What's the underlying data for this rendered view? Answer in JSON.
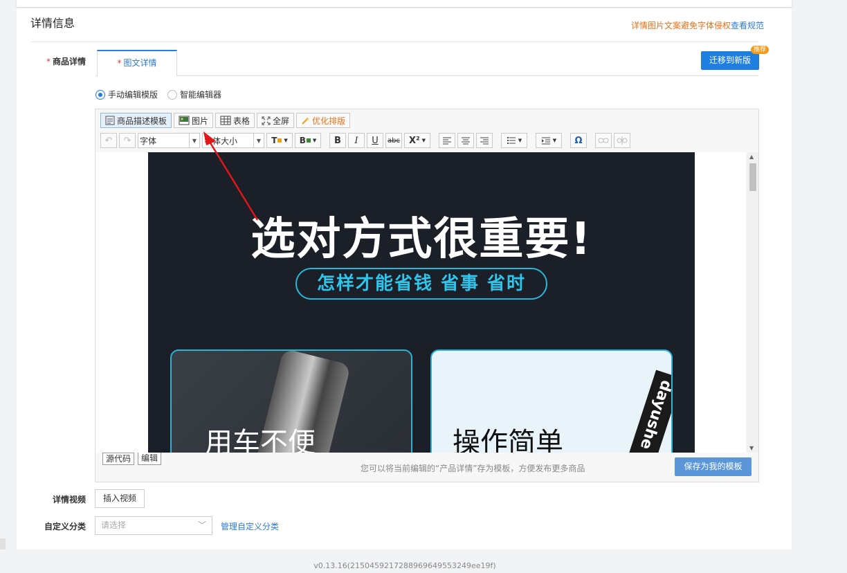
{
  "section": {
    "title": "详情信息"
  },
  "notice": {
    "text": "详情图片文案避免字体侵权",
    "link": "查看规范"
  },
  "detail": {
    "label": "商品详情",
    "required_mark": "*",
    "tab_label": "图文详情",
    "migrate_button": "迁移到新版",
    "migrate_badge": "推荐"
  },
  "modes": {
    "manual": "手动编辑模版",
    "smart": "智能编辑器",
    "selected": "manual"
  },
  "toolbar": {
    "template": "商品描述模板",
    "image": "图片",
    "table": "表格",
    "fullscreen": "全屏",
    "optimize": "优化排版",
    "font_placeholder": "字体",
    "fontsize_placeholder": "字体大小",
    "bold": "B",
    "italic": "I",
    "underline": "U",
    "strike": "abc",
    "superscript": "X²",
    "omega": "Ω"
  },
  "poster": {
    "headline": "选对方式很重要!",
    "subline": "怎样才能省钱 省事 省时",
    "left_panel": "用车不便",
    "right_panel": "操作简单",
    "bottle_text": "dayushe"
  },
  "editor_footer": {
    "source": "源代码",
    "edit": "编辑",
    "hint": "您可以将当前编辑的“产品详情”存为模板，方便发布更多商品",
    "save_template": "保存为我的模板"
  },
  "video": {
    "label": "详情视频",
    "button": "插入视频"
  },
  "category": {
    "label": "自定义分类",
    "placeholder": "请选择",
    "manage": "管理自定义分类"
  },
  "version": "v0.13.16(2150459217288969649553249ee19f)",
  "colors": {
    "accent": "#1f7fe0",
    "warn": "#e8711a",
    "poster_bg": "#1b1f28",
    "poster_cyan": "#2ec5ec",
    "annotation": "#e0161b"
  }
}
